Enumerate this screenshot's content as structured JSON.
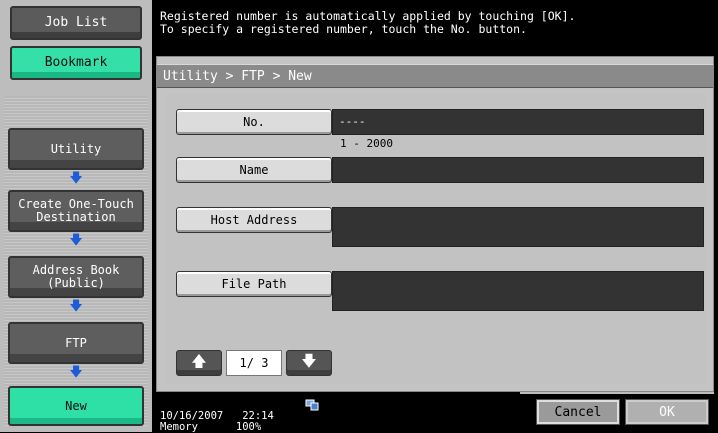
{
  "tabs": {
    "job_list": "Job List",
    "bookmark": "Bookmark"
  },
  "message": {
    "line1": "Registered number is automatically applied by touching [OK].",
    "line2": "To specify a registered number, touch the No. button."
  },
  "breadcrumb_nav": [
    {
      "label": "Utility"
    },
    {
      "label": "Create One-Touch\nDestination"
    },
    {
      "label": "Address Book\n(Public)"
    },
    {
      "label": "FTP"
    },
    {
      "label": "New"
    }
  ],
  "panel": {
    "title": "Utility > FTP > New"
  },
  "fields": {
    "number": {
      "label": "No.",
      "value": "----",
      "range_hint": "1 - 2000"
    },
    "name": {
      "label": "Name",
      "value": ""
    },
    "host_address": {
      "label": "Host Address",
      "value": ""
    },
    "file_path": {
      "label": "File Path",
      "value": ""
    }
  },
  "pager": {
    "current": "1/ 3"
  },
  "footer": {
    "date": "10/16/2007",
    "time": "22:14",
    "memory_label": "Memory",
    "memory_value": "100%"
  },
  "actions": {
    "cancel": "Cancel",
    "ok": "OK"
  },
  "icons": {
    "up": "arrow-up-icon",
    "down": "arrow-down-icon",
    "nav_arrow": "arrow-down-icon",
    "status": "network-icon"
  },
  "colors": {
    "active_green": "#2fe0a6",
    "arrow_blue": "#1e5bd6"
  }
}
